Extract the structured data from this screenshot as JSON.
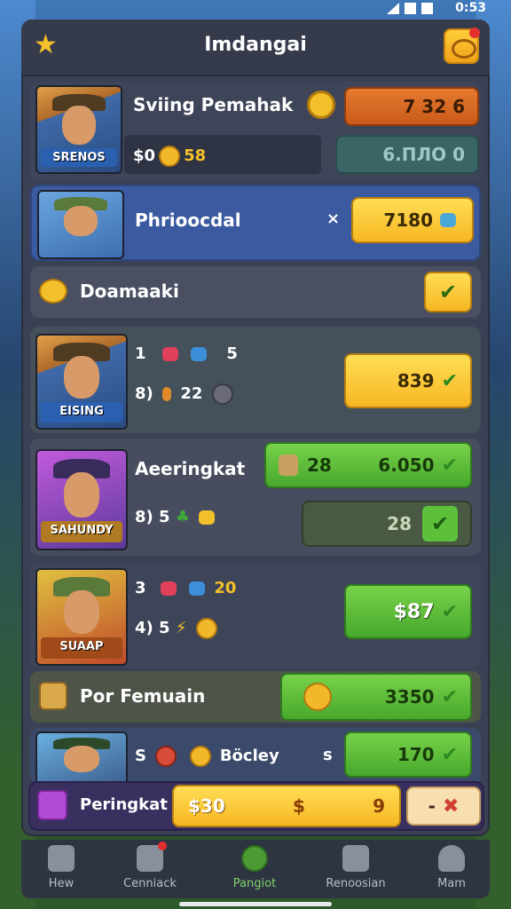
{
  "status": {
    "time": "0:53"
  },
  "header": {
    "title": "Imdangai"
  },
  "rows": [
    {
      "title": "Sviing Pemahak",
      "avatar_label": "SRENOS",
      "stat": "$0",
      "coins": "58",
      "primary": "7 32 6",
      "secondary": "6.ПЛО 0"
    },
    {
      "title": "Phrioocdal",
      "mark": "×",
      "primary": "7180"
    },
    {
      "title": "Doamaaki"
    },
    {
      "avatar_label": "EISING",
      "line1_a": "1",
      "line1_b": "5",
      "line2_a": "8)",
      "line2_b": "22",
      "primary": "839"
    },
    {
      "title": "Aeeringkat",
      "avatar_label": "SAHUNDY",
      "stat": "8) 5",
      "chip_value": "28",
      "primary": "6.050",
      "secondary": "28"
    },
    {
      "avatar_label": "SUAAP",
      "line1_a": "3",
      "line1_b": "20",
      "line2_a": "4) 5",
      "primary": "$87"
    },
    {
      "title": "Por Femuain",
      "primary": "3350"
    },
    {
      "title": "Böcley",
      "prefix": "S",
      "mark": "s",
      "primary": "170"
    }
  ],
  "bottom_strip": {
    "title": "Peringkat",
    "value": "$30",
    "mid_a": "$",
    "mid_b": "9",
    "action": "-"
  },
  "tabs": [
    {
      "label": "Hew"
    },
    {
      "label": "Cenniack"
    },
    {
      "label": "Pangiot"
    },
    {
      "label": "Renoosian"
    },
    {
      "label": "Mam"
    }
  ]
}
